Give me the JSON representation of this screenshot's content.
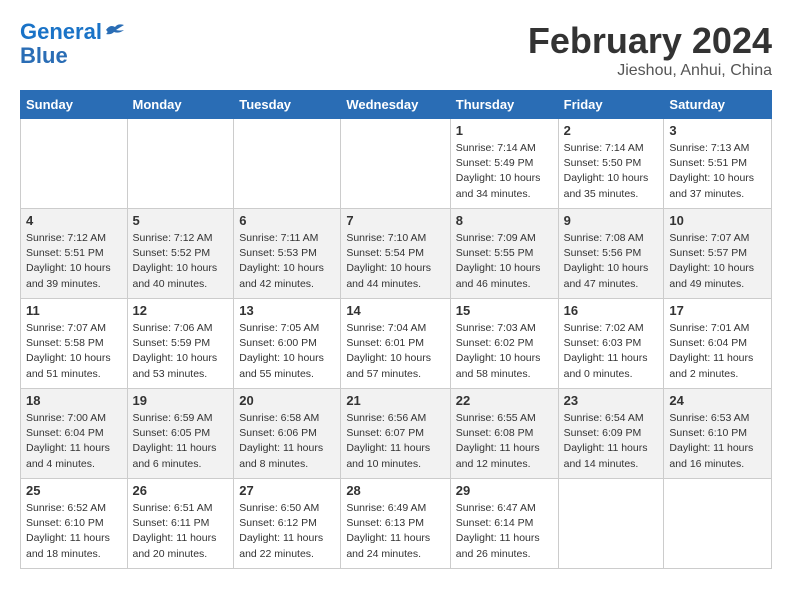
{
  "header": {
    "logo_line1": "General",
    "logo_line2": "Blue",
    "month": "February 2024",
    "location": "Jieshou, Anhui, China"
  },
  "weekdays": [
    "Sunday",
    "Monday",
    "Tuesday",
    "Wednesday",
    "Thursday",
    "Friday",
    "Saturday"
  ],
  "weeks": [
    [
      {
        "day": "",
        "info": ""
      },
      {
        "day": "",
        "info": ""
      },
      {
        "day": "",
        "info": ""
      },
      {
        "day": "",
        "info": ""
      },
      {
        "day": "1",
        "info": "Sunrise: 7:14 AM\nSunset: 5:49 PM\nDaylight: 10 hours\nand 34 minutes."
      },
      {
        "day": "2",
        "info": "Sunrise: 7:14 AM\nSunset: 5:50 PM\nDaylight: 10 hours\nand 35 minutes."
      },
      {
        "day": "3",
        "info": "Sunrise: 7:13 AM\nSunset: 5:51 PM\nDaylight: 10 hours\nand 37 minutes."
      }
    ],
    [
      {
        "day": "4",
        "info": "Sunrise: 7:12 AM\nSunset: 5:51 PM\nDaylight: 10 hours\nand 39 minutes."
      },
      {
        "day": "5",
        "info": "Sunrise: 7:12 AM\nSunset: 5:52 PM\nDaylight: 10 hours\nand 40 minutes."
      },
      {
        "day": "6",
        "info": "Sunrise: 7:11 AM\nSunset: 5:53 PM\nDaylight: 10 hours\nand 42 minutes."
      },
      {
        "day": "7",
        "info": "Sunrise: 7:10 AM\nSunset: 5:54 PM\nDaylight: 10 hours\nand 44 minutes."
      },
      {
        "day": "8",
        "info": "Sunrise: 7:09 AM\nSunset: 5:55 PM\nDaylight: 10 hours\nand 46 minutes."
      },
      {
        "day": "9",
        "info": "Sunrise: 7:08 AM\nSunset: 5:56 PM\nDaylight: 10 hours\nand 47 minutes."
      },
      {
        "day": "10",
        "info": "Sunrise: 7:07 AM\nSunset: 5:57 PM\nDaylight: 10 hours\nand 49 minutes."
      }
    ],
    [
      {
        "day": "11",
        "info": "Sunrise: 7:07 AM\nSunset: 5:58 PM\nDaylight: 10 hours\nand 51 minutes."
      },
      {
        "day": "12",
        "info": "Sunrise: 7:06 AM\nSunset: 5:59 PM\nDaylight: 10 hours\nand 53 minutes."
      },
      {
        "day": "13",
        "info": "Sunrise: 7:05 AM\nSunset: 6:00 PM\nDaylight: 10 hours\nand 55 minutes."
      },
      {
        "day": "14",
        "info": "Sunrise: 7:04 AM\nSunset: 6:01 PM\nDaylight: 10 hours\nand 57 minutes."
      },
      {
        "day": "15",
        "info": "Sunrise: 7:03 AM\nSunset: 6:02 PM\nDaylight: 10 hours\nand 58 minutes."
      },
      {
        "day": "16",
        "info": "Sunrise: 7:02 AM\nSunset: 6:03 PM\nDaylight: 11 hours\nand 0 minutes."
      },
      {
        "day": "17",
        "info": "Sunrise: 7:01 AM\nSunset: 6:04 PM\nDaylight: 11 hours\nand 2 minutes."
      }
    ],
    [
      {
        "day": "18",
        "info": "Sunrise: 7:00 AM\nSunset: 6:04 PM\nDaylight: 11 hours\nand 4 minutes."
      },
      {
        "day": "19",
        "info": "Sunrise: 6:59 AM\nSunset: 6:05 PM\nDaylight: 11 hours\nand 6 minutes."
      },
      {
        "day": "20",
        "info": "Sunrise: 6:58 AM\nSunset: 6:06 PM\nDaylight: 11 hours\nand 8 minutes."
      },
      {
        "day": "21",
        "info": "Sunrise: 6:56 AM\nSunset: 6:07 PM\nDaylight: 11 hours\nand 10 minutes."
      },
      {
        "day": "22",
        "info": "Sunrise: 6:55 AM\nSunset: 6:08 PM\nDaylight: 11 hours\nand 12 minutes."
      },
      {
        "day": "23",
        "info": "Sunrise: 6:54 AM\nSunset: 6:09 PM\nDaylight: 11 hours\nand 14 minutes."
      },
      {
        "day": "24",
        "info": "Sunrise: 6:53 AM\nSunset: 6:10 PM\nDaylight: 11 hours\nand 16 minutes."
      }
    ],
    [
      {
        "day": "25",
        "info": "Sunrise: 6:52 AM\nSunset: 6:10 PM\nDaylight: 11 hours\nand 18 minutes."
      },
      {
        "day": "26",
        "info": "Sunrise: 6:51 AM\nSunset: 6:11 PM\nDaylight: 11 hours\nand 20 minutes."
      },
      {
        "day": "27",
        "info": "Sunrise: 6:50 AM\nSunset: 6:12 PM\nDaylight: 11 hours\nand 22 minutes."
      },
      {
        "day": "28",
        "info": "Sunrise: 6:49 AM\nSunset: 6:13 PM\nDaylight: 11 hours\nand 24 minutes."
      },
      {
        "day": "29",
        "info": "Sunrise: 6:47 AM\nSunset: 6:14 PM\nDaylight: 11 hours\nand 26 minutes."
      },
      {
        "day": "",
        "info": ""
      },
      {
        "day": "",
        "info": ""
      }
    ]
  ]
}
